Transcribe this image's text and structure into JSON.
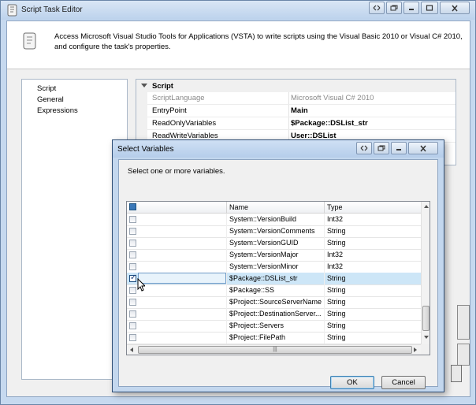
{
  "window": {
    "title": "Script Task Editor",
    "description": "Access Microsoft Visual Studio Tools for Applications (VSTA) to write scripts using the Visual Basic 2010 or Visual C# 2010, and configure the task's properties."
  },
  "left_nav": {
    "items": [
      {
        "label": "Script"
      },
      {
        "label": "General"
      },
      {
        "label": "Expressions"
      }
    ]
  },
  "property_grid": {
    "category": "Script",
    "rows": [
      {
        "name": "ScriptLanguage",
        "value": "Microsoft Visual C# 2010",
        "disabled": true
      },
      {
        "name": "EntryPoint",
        "value": "Main",
        "disabled": false
      },
      {
        "name": "ReadOnlyVariables",
        "value": "$Package::DSList_str",
        "disabled": false
      },
      {
        "name": "ReadWriteVariables",
        "value": "User::DSList",
        "disabled": false
      }
    ]
  },
  "dialog": {
    "title": "Select Variables",
    "hint": "Select one or more variables.",
    "columns": {
      "name": "Name",
      "type": "Type"
    },
    "rows": [
      {
        "name": "System::VersionBuild",
        "type": "Int32",
        "checked": false
      },
      {
        "name": "System::VersionComments",
        "type": "String",
        "checked": false
      },
      {
        "name": "System::VersionGUID",
        "type": "String",
        "checked": false
      },
      {
        "name": "System::VersionMajor",
        "type": "Int32",
        "checked": false
      },
      {
        "name": "System::VersionMinor",
        "type": "Int32",
        "checked": false
      },
      {
        "name": "$Package::DSList_str",
        "type": "String",
        "checked": true
      },
      {
        "name": "$Package::SS",
        "type": "String",
        "checked": false
      },
      {
        "name": "$Project::SourceServerName",
        "type": "String",
        "checked": false
      },
      {
        "name": "$Project::DestinationServer...",
        "type": "String",
        "checked": false
      },
      {
        "name": "$Project::Servers",
        "type": "String",
        "checked": false
      },
      {
        "name": "$Project::FilePath",
        "type": "String",
        "checked": false
      }
    ],
    "ok_label": "OK",
    "cancel_label": "Cancel"
  },
  "icons": {
    "window_icon": "script-scroll-icon",
    "description_icon": "script-scroll-icon",
    "cursor": "mouse-pointer-icon"
  },
  "colors": {
    "selected_row": "#cde6f7",
    "title_bar": "#c6d9ef",
    "accent_border": "#3c7fb1"
  }
}
